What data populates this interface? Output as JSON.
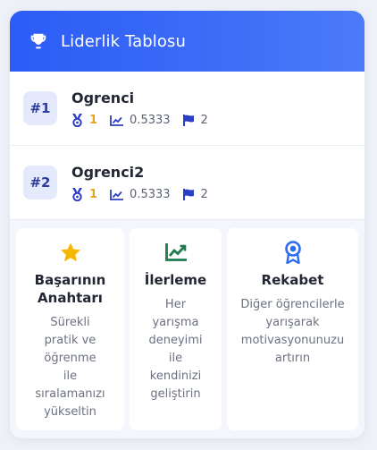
{
  "header": {
    "title": "Liderlik Tablosu",
    "icon": "trophy-icon"
  },
  "entries": [
    {
      "rank": "#1",
      "name": "Ogrenci",
      "medals": "1",
      "score": "0.5333",
      "flags": "2"
    },
    {
      "rank": "#2",
      "name": "Ogrenci2",
      "medals": "1",
      "score": "0.5333",
      "flags": "2"
    }
  ],
  "tips": [
    {
      "icon": "star-icon",
      "title_lines": [
        "Başarının",
        "Anahtarı"
      ],
      "text_lines": [
        "Sürekli",
        "pratik ve",
        "öğrenme",
        "ile",
        "sıralamanızı",
        "yükseltin"
      ]
    },
    {
      "icon": "chart-line-icon",
      "title_lines": [
        "İlerleme"
      ],
      "text_lines": [
        "Her",
        "yarışma",
        "deneyimi",
        "ile",
        "kendinizi",
        "geliştirin"
      ]
    },
    {
      "icon": "award-icon",
      "title_lines": [
        "Rekabet"
      ],
      "text_lines": [
        "Diğer öğrencilerle",
        "yarışarak",
        "motivasyonunuzu",
        "artırın"
      ]
    }
  ],
  "colors": {
    "header_gradient_start": "#2b5cf6",
    "header_gradient_end": "#4b7bf8",
    "rank_badge_bg": "#e4e9fb",
    "rank_text": "#2c3e9c",
    "medal": "#e5a713",
    "stat_icon": "#2c3ec4",
    "star": "#f5b700",
    "chart_green": "#1f7a4d",
    "award_blue": "#2b6cf0"
  }
}
